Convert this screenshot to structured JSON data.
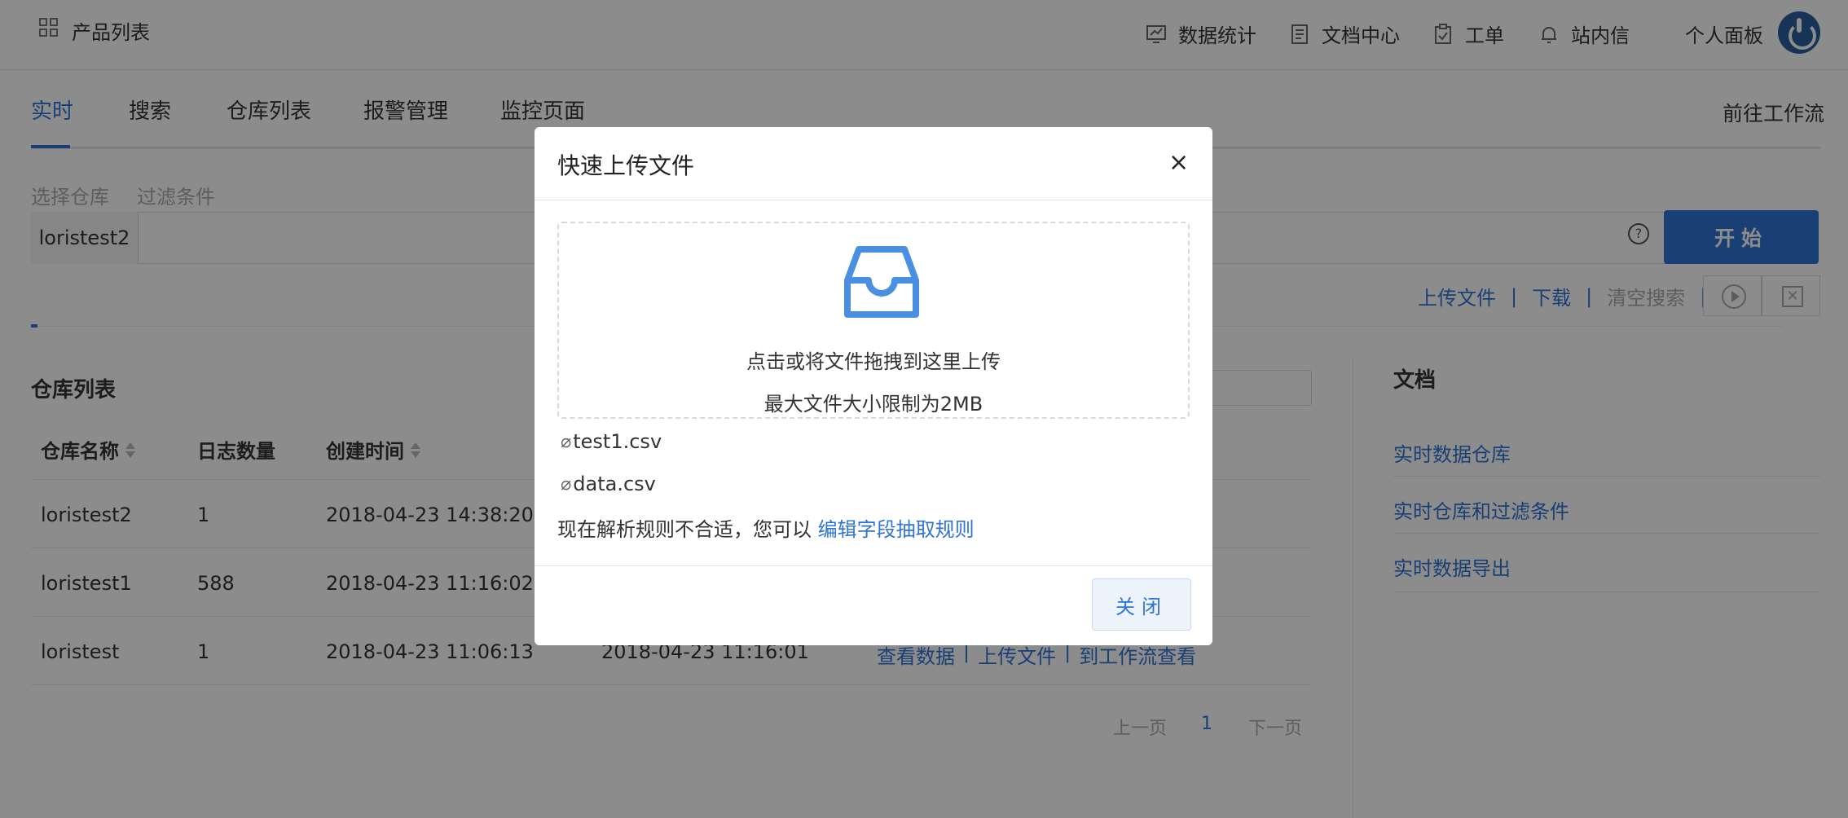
{
  "topbar": {
    "title": "产品列表",
    "nav": [
      "数据统计",
      "文档中心",
      "工单",
      "站内信",
      "个人面板"
    ],
    "nav_icons": [
      "chart-icon",
      "document-icon",
      "clipboard-icon",
      "bell-icon"
    ]
  },
  "tabs": {
    "items": [
      "实时",
      "搜索",
      "仓库列表",
      "报警管理",
      "监控页面"
    ],
    "active": "实时",
    "goto_flow": "前往工作流"
  },
  "filter": {
    "repo_label": "选择仓库",
    "cond_label": "过滤条件",
    "repo_value": "loristest2",
    "help": "?",
    "start": "开始"
  },
  "actions": {
    "upload": "上传文件",
    "download": "下载",
    "clear": "清空搜索",
    "sep": "|"
  },
  "repo_table": {
    "title": "仓库列表",
    "headers": [
      "仓库名称",
      "日志数量",
      "创建时间"
    ],
    "rows": [
      {
        "name": "loristest2",
        "count": "1",
        "created": "2018-04-23 14:38:20"
      },
      {
        "name": "loristest1",
        "count": "588",
        "created": "2018-04-23 11:16:02"
      },
      {
        "name": "loristest",
        "count": "1",
        "created": "2018-04-23 11:06:13",
        "updated": "2018-04-23 11:16:01",
        "ops": [
          "查看数据",
          "上传文件",
          "到工作流查看"
        ]
      }
    ],
    "pager": {
      "prev": "上一页",
      "page": "1",
      "next": "下一页"
    }
  },
  "docs": {
    "title": "文档",
    "links": [
      "实时数据仓库",
      "实时仓库和过滤条件",
      "实时数据导出"
    ]
  },
  "modal": {
    "title": "快速上传文件",
    "close_x": "×",
    "dz_line1": "点击或将文件拖拽到这里上传",
    "dz_line2": "最大文件大小限制为2MB",
    "files": [
      "test1.csv",
      "data.csv"
    ],
    "rule_prefix": "现在解析规则不合适，您可以",
    "rule_link": "编辑字段抽取规则",
    "close_btn": "关闭",
    "accent": "#2f73d6"
  }
}
